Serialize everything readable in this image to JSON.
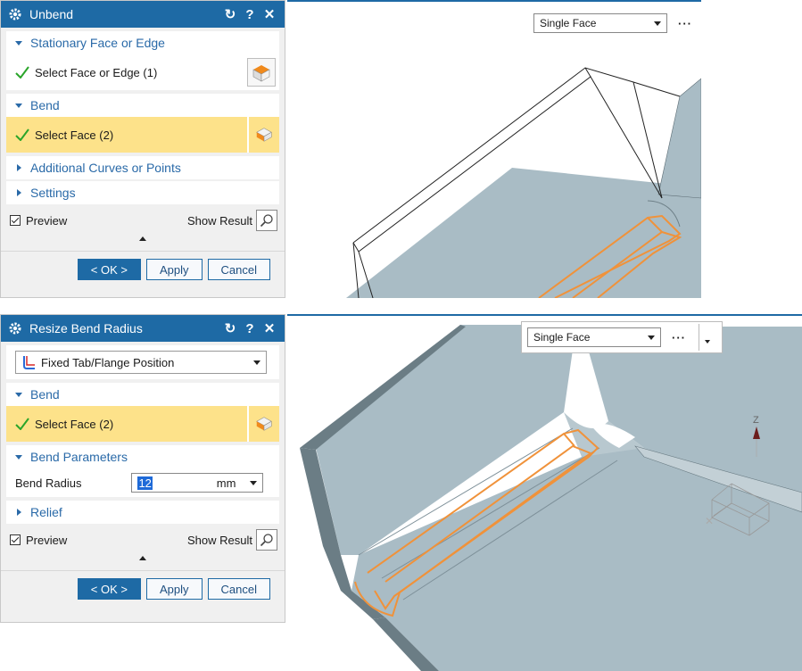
{
  "unbend": {
    "title": "Unbend",
    "sections": {
      "stationary": "Stationary Face or Edge",
      "stationary_select": "Select Face or Edge (1)",
      "bend": "Bend",
      "bend_select": "Select Face (2)",
      "additional": "Additional Curves or Points",
      "settings": "Settings"
    },
    "preview_label": "Preview",
    "show_result_label": "Show Result",
    "buttons": {
      "ok": "< OK >",
      "apply": "Apply",
      "cancel": "Cancel"
    }
  },
  "resize": {
    "title": "Resize Bend Radius",
    "method": "Fixed Tab/Flange Position",
    "sections": {
      "bend": "Bend",
      "bend_select": "Select Face (2)",
      "parameters": "Bend Parameters",
      "relief": "Relief"
    },
    "bend_radius_label": "Bend Radius",
    "bend_radius_value": "12",
    "bend_radius_unit": "mm",
    "preview_label": "Preview",
    "show_result_label": "Show Result",
    "buttons": {
      "ok": "< OK >",
      "apply": "Apply",
      "cancel": "Cancel"
    }
  },
  "viewport_top": {
    "filter": "Single Face",
    "more": "···"
  },
  "viewport_bottom": {
    "filter": "Single Face",
    "more": "···",
    "axis_label": "Z"
  },
  "colors": {
    "accent": "#1e6aa5",
    "highlight": "#fde28a",
    "selection": "#f0923a",
    "model": "#a9bcc5"
  }
}
